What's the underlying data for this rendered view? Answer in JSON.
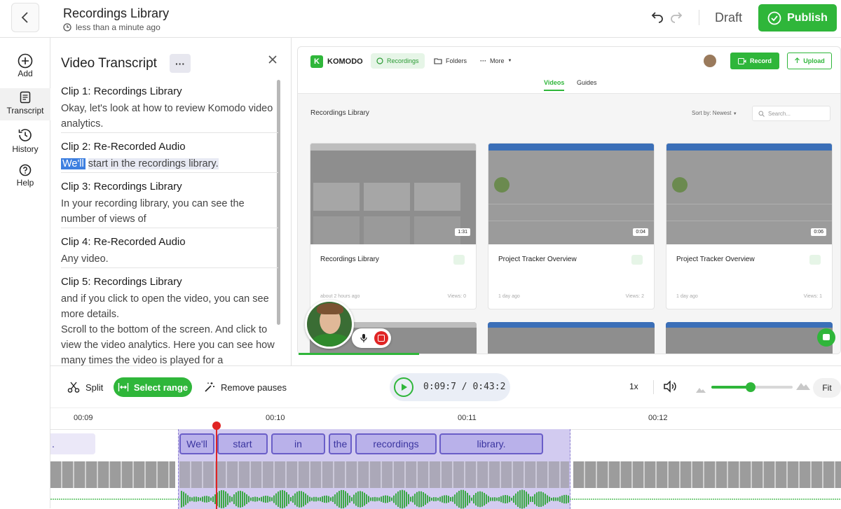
{
  "header": {
    "title": "Recordings Library",
    "subtitle": "less than a minute ago",
    "status": "Draft",
    "publish_label": "Publish"
  },
  "rail": {
    "items": [
      {
        "label": "Add"
      },
      {
        "label": "Transcript"
      },
      {
        "label": "History"
      },
      {
        "label": "Help"
      }
    ]
  },
  "transcript": {
    "title": "Video Transcript",
    "more_label": "···",
    "clips": [
      {
        "title": "Clip 1: Recordings Library",
        "text": "Okay, let's look at how to review Komodo video analytics."
      },
      {
        "title": "Clip 2: Re-Recorded Audio",
        "highlight": "We'll",
        "text": "start in the recordings library."
      },
      {
        "title": "Clip 3: Recordings Library",
        "text": "In your recording library, you can see the number of views of"
      },
      {
        "title": "Clip 4: Re-Recorded Audio",
        "text": "Any video."
      },
      {
        "title": "Clip 5: Recordings Library",
        "text": "and if you click to open the video, you can see more details.",
        "extra": "Scroll to the bottom of the screen. And click to view the video analytics. Here you can see how many times the video is played for a"
      }
    ]
  },
  "preview": {
    "logo": "KOMODO",
    "logo_letter": "K",
    "tabs": [
      "Recordings",
      "Folders",
      "More"
    ],
    "record_label": "Record",
    "upload_label": "Upload",
    "subtabs": [
      "Videos",
      "Guides"
    ],
    "library_title": "Recordings Library",
    "sort_label": "Sort by: Newest",
    "search_placeholder": "Search...",
    "cards": [
      {
        "title": "Recordings Library",
        "duration": "1:31",
        "meta": "about 2 hours ago",
        "views": "Views: 0"
      },
      {
        "title": "Project Tracker Overview",
        "duration": "0:04",
        "meta": "1 day ago",
        "views": "Views: 2"
      },
      {
        "title": "Project Tracker Overview",
        "duration": "0:06",
        "meta": "1 day ago",
        "views": "Views: 1"
      }
    ]
  },
  "toolbar": {
    "split_label": "Split",
    "select_range_label": "Select range",
    "remove_pauses_label": "Remove pauses",
    "time": "0:09:7 / 0:43:2",
    "speed": "1x",
    "fit_label": "Fit",
    "zoom_level": 0.48
  },
  "timeline": {
    "ticks": [
      "00:09",
      "00:10",
      "00:11",
      "00:12"
    ],
    "prev_word": ".",
    "words": [
      "We'll",
      "start",
      "in",
      "the",
      "recordings",
      "library."
    ]
  },
  "colors": {
    "accent": "#2fb63a",
    "selection": "#d2cbf0",
    "playhead": "#e02424"
  }
}
